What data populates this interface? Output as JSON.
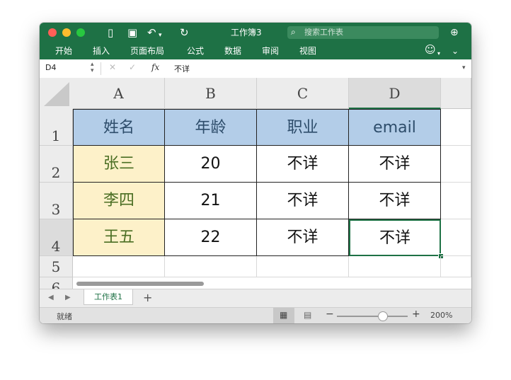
{
  "window": {
    "title": "工作簿3"
  },
  "search": {
    "placeholder": "搜索工作表"
  },
  "menu": [
    "开始",
    "插入",
    "页面布局",
    "公式",
    "数据",
    "审阅",
    "视图"
  ],
  "formula_bar": {
    "name_box": "D4",
    "fx_label": "fx",
    "value": "不详"
  },
  "columns": [
    "A",
    "B",
    "C",
    "D"
  ],
  "rows": [
    "1",
    "2",
    "3",
    "4",
    "5",
    "6"
  ],
  "table": {
    "headers": [
      "姓名",
      "年龄",
      "职业",
      "email"
    ],
    "records": [
      [
        "张三",
        "20",
        "不详",
        "不详"
      ],
      [
        "李四",
        "21",
        "不详",
        "不详"
      ],
      [
        "王五",
        "22",
        "不详",
        "不详"
      ]
    ]
  },
  "sheet_tabs": {
    "active": "工作表1",
    "add": "+"
  },
  "status_bar": {
    "status": "就绪",
    "zoom": "200%"
  },
  "colors": {
    "ribbon": "#1e7145",
    "header_fill": "#b3cde8",
    "name_fill": "#fdf1c9"
  }
}
